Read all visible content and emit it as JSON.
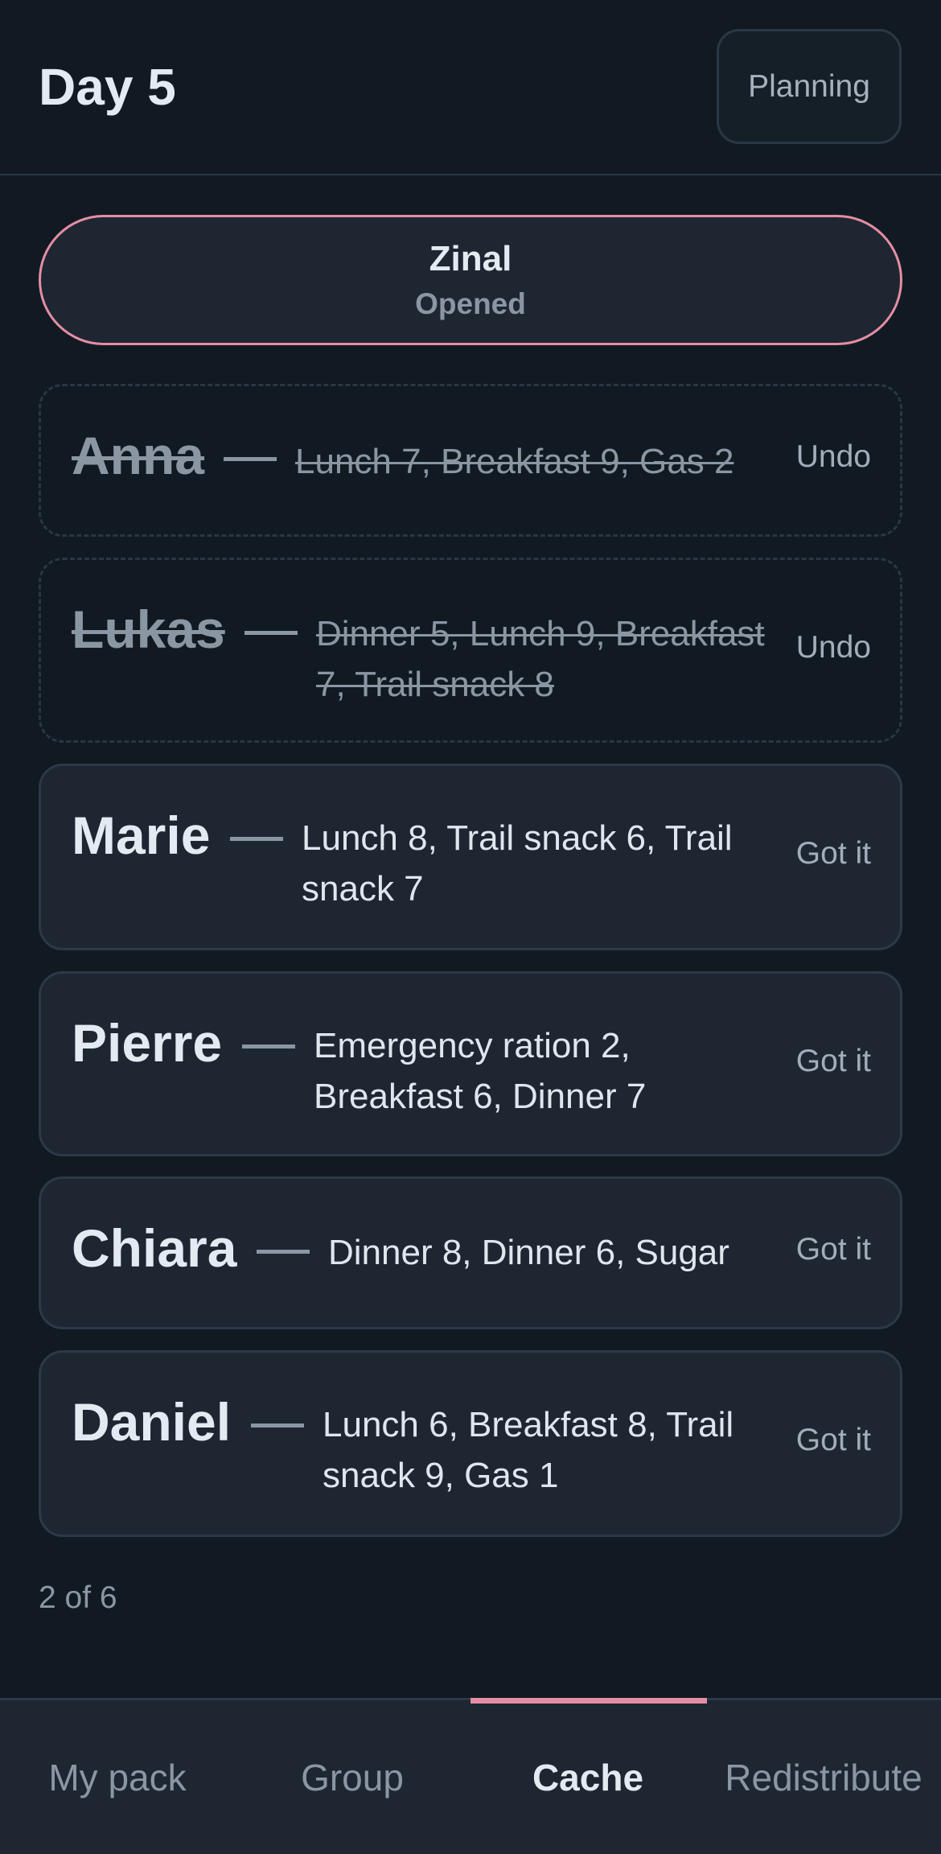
{
  "header": {
    "title": "Day 5",
    "planning_label": "Planning"
  },
  "cache": {
    "name": "Zinal",
    "status": "Opened"
  },
  "entries": [
    {
      "name": "Anna",
      "dash": "—",
      "items": "Lunch 7, Breakfast 9, Gas 2",
      "action": "Undo",
      "done": true
    },
    {
      "name": "Lukas",
      "dash": "—",
      "items": "Dinner 5, Lunch 9, Breakfast 7, Trail snack 8",
      "action": "Undo",
      "done": true
    },
    {
      "name": "Marie",
      "dash": "—",
      "items": "Lunch 8, Trail snack 6, Trail snack 7",
      "action": "Got it",
      "done": false
    },
    {
      "name": "Pierre",
      "dash": "—",
      "items": "Emergency ration 2, Breakfast 6, Dinner 7",
      "action": "Got it",
      "done": false
    },
    {
      "name": "Chiara",
      "dash": "—",
      "items": "Dinner 8, Dinner 6, Sugar",
      "action": "Got it",
      "done": false
    },
    {
      "name": "Daniel",
      "dash": "—",
      "items": "Lunch 6, Breakfast 8, Trail snack 9, Gas 1",
      "action": "Got it",
      "done": false
    }
  ],
  "progress": {
    "text": "2 of 6",
    "done": 2,
    "total": 6
  },
  "tabs": [
    {
      "label": "My pack",
      "active": false
    },
    {
      "label": "Group",
      "active": false
    },
    {
      "label": "Cache",
      "active": true
    },
    {
      "label": "Redistribute",
      "active": false
    }
  ],
  "colors": {
    "accent": "#e58da4",
    "background": "#111a22",
    "card": "#1d2631"
  }
}
